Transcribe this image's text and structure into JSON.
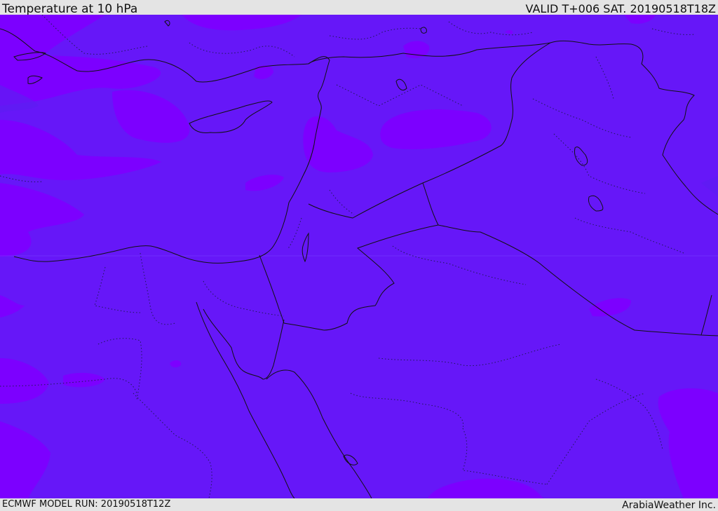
{
  "header": {
    "title": "Temperature at 10 hPa",
    "valid": "VALID T+006 SAT. 20190518T18Z"
  },
  "footer": {
    "model_run": "ECMWF MODEL RUN: 20190518T12Z",
    "credit": "ArabiaWeather Inc."
  },
  "colors": {
    "field_base": "#6617f8",
    "field_warm_patch": "#7c00ff",
    "field_cool_patch": "#5a1ff0",
    "coastline": "#111111",
    "border_dotted": "#222244",
    "background": "#e4e4e4"
  }
}
